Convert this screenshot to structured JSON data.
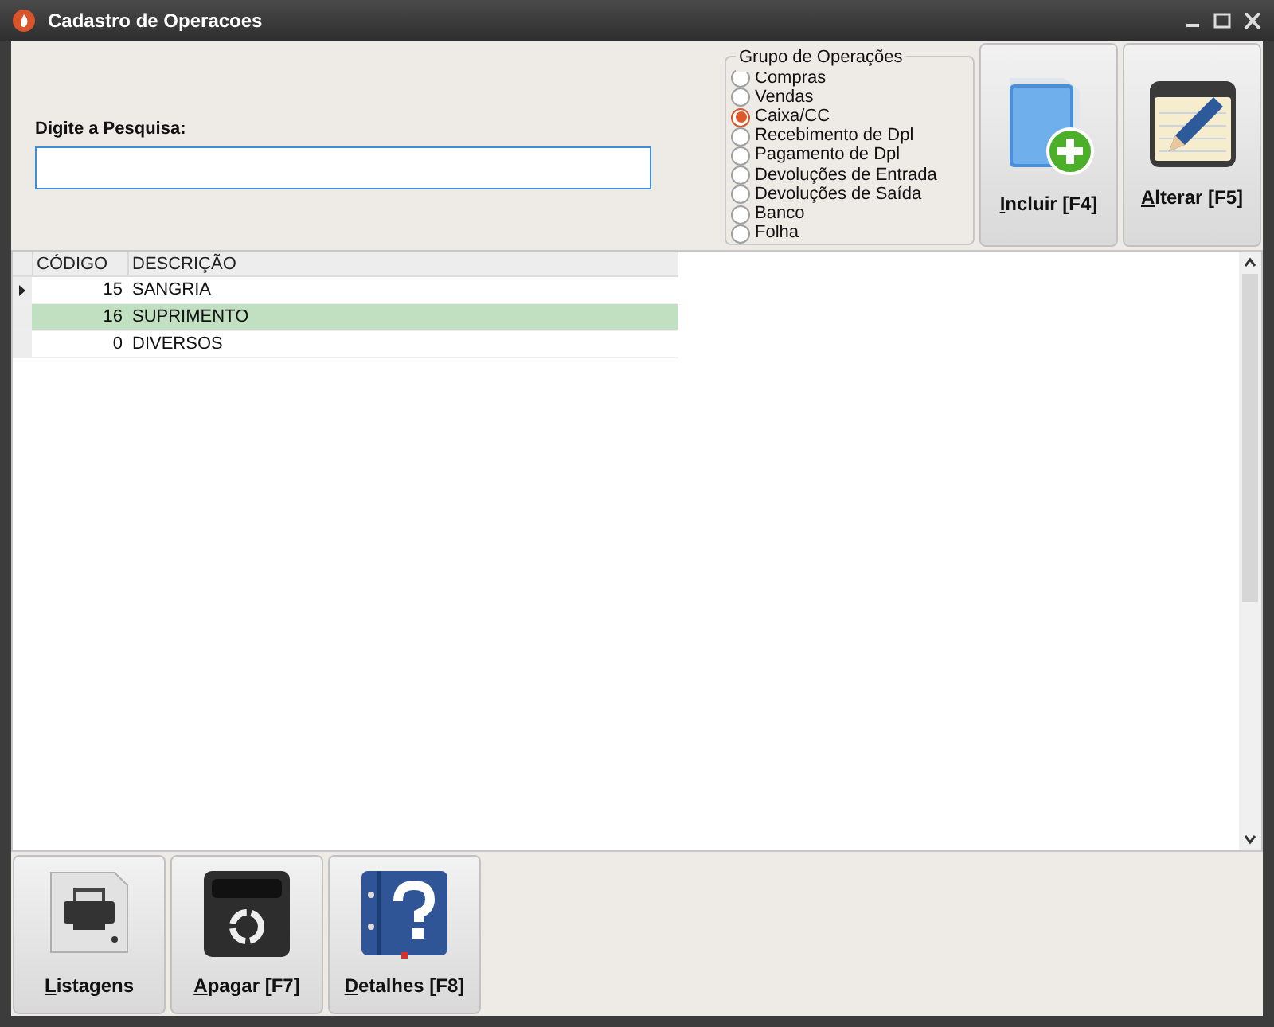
{
  "window": {
    "title": "Cadastro de Operacoes"
  },
  "search": {
    "label": "Digite a Pesquisa:"
  },
  "group": {
    "title": "Grupo de Operações",
    "options": [
      {
        "label": "Compras",
        "selected": false
      },
      {
        "label": "Vendas",
        "selected": false
      },
      {
        "label": "Caixa/CC",
        "selected": true
      },
      {
        "label": "Recebimento de Dpl",
        "selected": false
      },
      {
        "label": "Pagamento de Dpl",
        "selected": false
      },
      {
        "label": "Devoluções de Entrada",
        "selected": false
      },
      {
        "label": "Devoluções de Saída",
        "selected": false
      },
      {
        "label": "Banco",
        "selected": false
      },
      {
        "label": "Folha",
        "selected": false
      }
    ]
  },
  "top_buttons": [
    {
      "kind": "add",
      "label": "Incluir [F4]"
    },
    {
      "kind": "edit",
      "label": "Alterar [F5]"
    }
  ],
  "table": {
    "columns": [
      "CÓDIGO",
      "DESCRIÇÃO"
    ],
    "rows": [
      {
        "cells": [
          "15",
          "SANGRIA"
        ],
        "current": true,
        "selected": false
      },
      {
        "cells": [
          "16",
          "SUPRIMENTO"
        ],
        "current": false,
        "selected": true
      },
      {
        "cells": [
          "0",
          "DIVERSOS"
        ],
        "current": false,
        "selected": false
      }
    ]
  },
  "bottom_buttons": [
    {
      "kind": "print",
      "label": "Listagens"
    },
    {
      "kind": "delete",
      "label": "Apagar [F7]"
    },
    {
      "kind": "help",
      "label": "Detalhes [F8]"
    }
  ]
}
